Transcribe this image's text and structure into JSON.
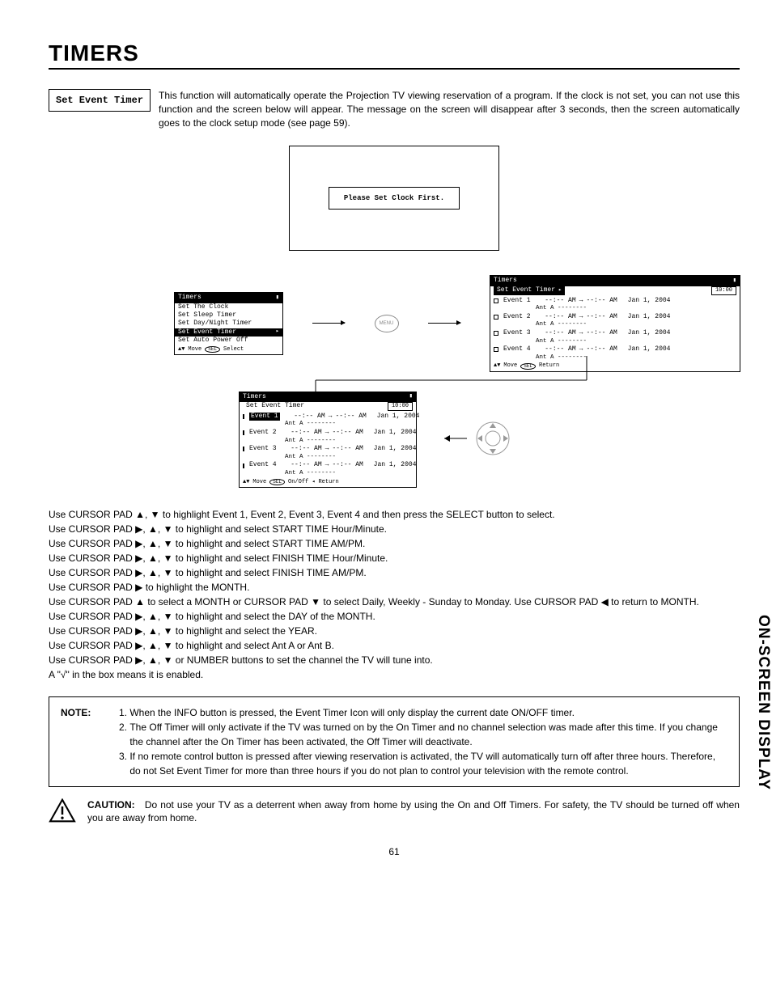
{
  "page": {
    "title": "TIMERS",
    "section_label": "Set Event Timer",
    "intro": "This function will automatically operate the Projection TV viewing reservation of a program.  If the clock is not set, you can not use this function and the screen below will appear.  The message on the screen will disappear after 3 seconds, then the screen automatically goes to the clock setup mode (see page 59).",
    "page_number": "61",
    "side_tab": "ON-SCREEN DISPLAY"
  },
  "clock_msg": "Please Set Clock First.",
  "timers_menu": {
    "title": "Timers",
    "items": [
      "Set The Clock",
      "Set Sleep Timer",
      "Set Day/Night Timer",
      "Set Event Timer",
      "Set Auto Power Off"
    ],
    "highlighted_index": 3,
    "footer_move": "Move",
    "footer_sel": "Select",
    "sel_button": "SEL"
  },
  "events_menu_top": {
    "title": "Timers",
    "subtitle": "Set Event Timer",
    "clock": "10:00",
    "events": [
      {
        "label": "Event 1",
        "time": "--:-- AM",
        "time2": "--:-- AM",
        "date": "Jan 1, 2004",
        "sub": "Ant A --------"
      },
      {
        "label": "Event 2",
        "time": "--:-- AM",
        "time2": "--:-- AM",
        "date": "Jan 1, 2004",
        "sub": "Ant A --------"
      },
      {
        "label": "Event 3",
        "time": "--:-- AM",
        "time2": "--:-- AM",
        "date": "Jan 1, 2004",
        "sub": "Ant A --------"
      },
      {
        "label": "Event 4",
        "time": "--:-- AM",
        "time2": "--:-- AM",
        "date": "Jan 1, 2004",
        "sub": "Ant A --------"
      }
    ],
    "footer_move": "Move",
    "footer_ret": "Return",
    "ret_button": "SEL"
  },
  "events_menu_bottom": {
    "title": "Timers",
    "subtitle": "Set Event Timer",
    "clock": "10:00",
    "highlighted_event_index": 0,
    "events": [
      {
        "label": "Event 1",
        "time": "--:-- AM",
        "time2": "--:-- AM",
        "date": "Jan 1, 2004",
        "sub": "Ant A --------"
      },
      {
        "label": "Event 2",
        "time": "--:-- AM",
        "time2": "--:-- AM",
        "date": "Jan 1, 2004",
        "sub": "Ant A --------"
      },
      {
        "label": "Event 3",
        "time": "--:-- AM",
        "time2": "--:-- AM",
        "date": "Jan 1, 2004",
        "sub": "Ant A --------"
      },
      {
        "label": "Event 4",
        "time": "--:-- AM",
        "time2": "--:-- AM",
        "date": "Jan 1, 2004",
        "sub": "Ant A --------"
      }
    ],
    "footer_move": "Move",
    "footer_onoff": "On/Off",
    "footer_ret": "Return",
    "sel_button": "SEL"
  },
  "menu_button_label": "MENU",
  "instructions": [
    "Use CURSOR PAD ▲, ▼ to highlight Event 1, Event 2, Event 3, Event 4 and then press the SELECT button to select.",
    "Use CURSOR PAD ▶, ▲, ▼ to highlight and select START TIME Hour/Minute.",
    "Use CURSOR PAD ▶, ▲, ▼ to highlight and select START TIME AM/PM.",
    "Use CURSOR PAD ▶, ▲, ▼ to highlight and select FINISH TIME Hour/Minute.",
    "Use CURSOR PAD ▶, ▲, ▼ to highlight and select FINISH TIME AM/PM.",
    "Use CURSOR PAD ▶ to highlight the MONTH.",
    "Use CURSOR PAD ▲ to select a MONTH or CURSOR PAD ▼ to select Daily, Weekly - Sunday to Monday.  Use CURSOR PAD ◀ to return to MONTH.",
    "Use CURSOR PAD ▶, ▲, ▼ to highlight and select the DAY of the MONTH.",
    "Use CURSOR PAD ▶, ▲, ▼ to highlight and select the YEAR.",
    "Use CURSOR PAD ▶, ▲, ▼ to highlight and select Ant A or Ant B.",
    "Use CURSOR PAD ▶, ▲, ▼ or NUMBER buttons to set the channel the TV will tune into.",
    "A \"√\" in the box means it is enabled."
  ],
  "note": {
    "label": "NOTE:",
    "items": [
      "When the INFO button is pressed, the Event Timer Icon will only display the current date ON/OFF timer.",
      "The Off Timer will only activate if the TV was turned on by the On Timer and no channel selection was made after this time.  If you change the channel after the On Timer has been activated, the Off Timer will deactivate.",
      "If no remote control button is pressed after viewing reservation is activated, the TV will automatically turn off after three hours.  Therefore, do not Set Event Timer for more than three hours if you do not plan to control your television with the remote control."
    ]
  },
  "caution": {
    "label": "CAUTION:",
    "text": "Do not use your TV as a deterrent when away from home by using the On and Off Timers.  For safety, the TV should be turned off when you are away from home."
  }
}
